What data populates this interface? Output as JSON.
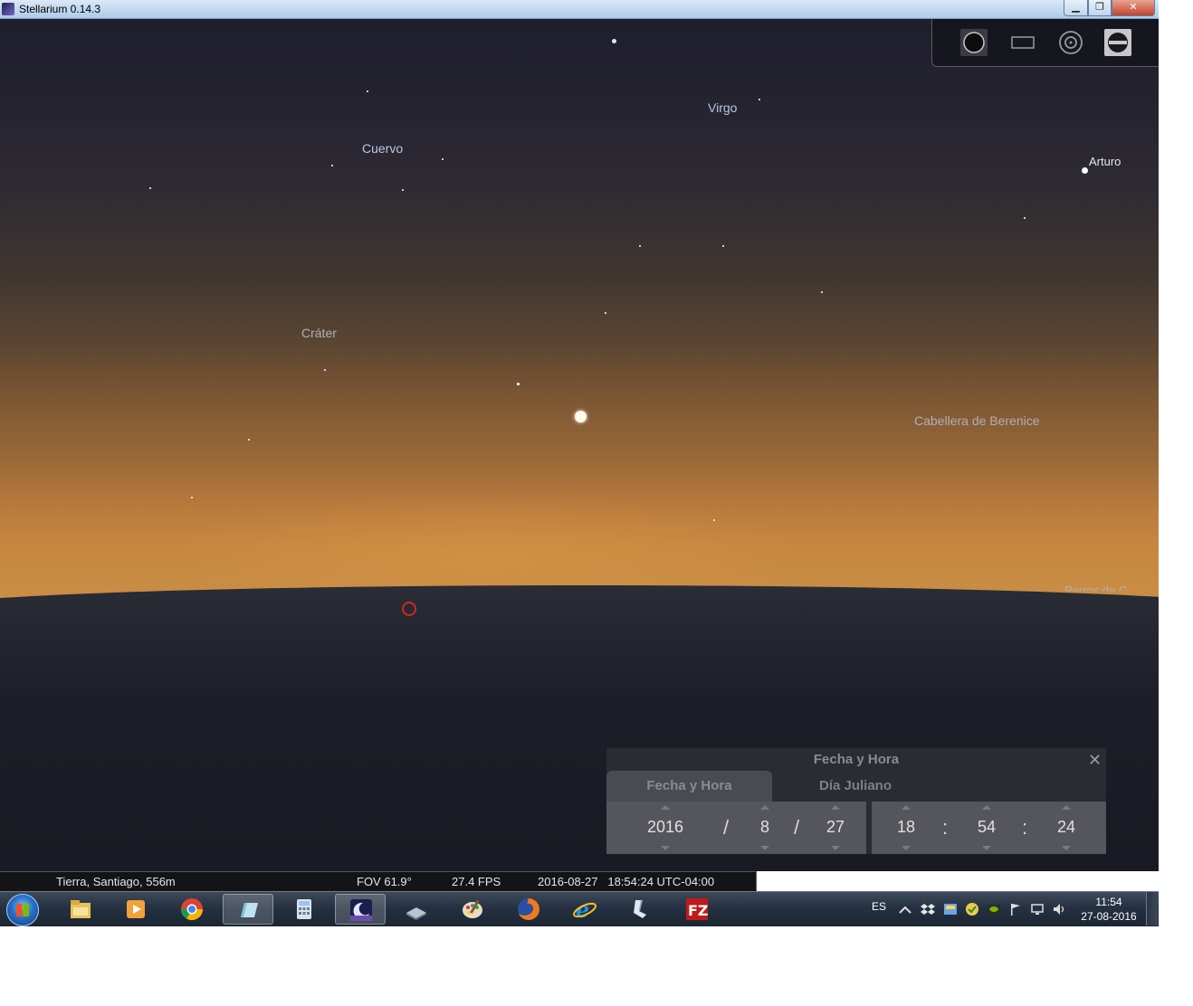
{
  "window": {
    "title": "Stellarium 0.14.3"
  },
  "sky": {
    "labels": {
      "virgo": "Virgo",
      "cuervo": "Cuervo",
      "arturo": "Arturo",
      "crater": "Cráter",
      "berenice": "Cabellera de Berenice",
      "perros": "Perros de C"
    }
  },
  "datetime_dialog": {
    "title": "Fecha y Hora",
    "close_glyph": "✕",
    "tab_date": "Fecha y Hora",
    "tab_julian": "Día Juliano",
    "year": "2016",
    "month": "8",
    "day": "27",
    "hour": "18",
    "minute": "54",
    "second": "24",
    "date_sep": "/",
    "time_sep": ":"
  },
  "status_bar": {
    "location": "Tierra, Santiago, 556m",
    "fov": "FOV 61.9°",
    "fps": "27.4 FPS",
    "datetime": "2016-08-27   18:54:24 UTC-04:00"
  },
  "taskbar": {
    "tray_lang": "ES",
    "clock_time": "11:54",
    "clock_date": "27-08-2016",
    "apps": [
      "file-explorer-icon",
      "media-player-icon",
      "chrome-icon",
      "notepad-icon",
      "calculator-icon",
      "stellarium-icon",
      "scanner-icon",
      "paint-icon",
      "firefox-icon",
      "internet-explorer-icon",
      "cleaner-icon",
      "filezilla-icon"
    ]
  },
  "colors": {
    "horizon": "#c98d45",
    "sky_top": "#1e1e2c",
    "target_marker": "#d12a1a"
  }
}
